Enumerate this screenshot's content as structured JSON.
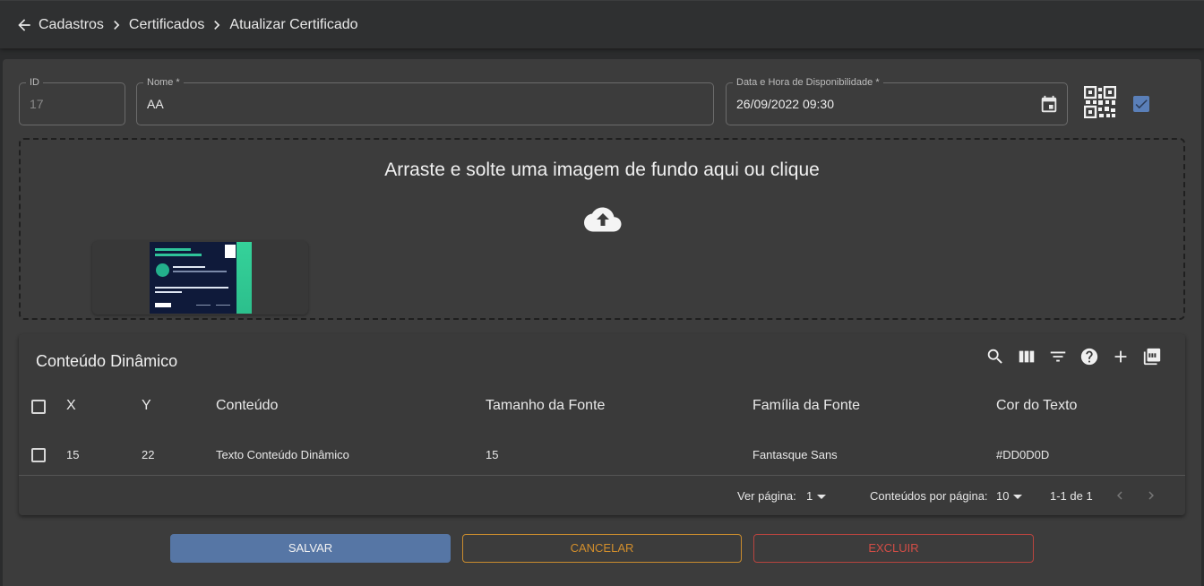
{
  "breadcrumb": {
    "items": [
      "Cadastros",
      "Certificados",
      "Atualizar Certificado"
    ]
  },
  "form": {
    "id": {
      "label": "ID",
      "value": "17"
    },
    "name": {
      "label": "Nome *",
      "value": "AA"
    },
    "availability": {
      "label": "Data e Hora de Disponibilidade *",
      "value": "26/09/2022 09:30"
    },
    "checkbox_checked": true
  },
  "dropzone": {
    "message": "Arraste e solte uma imagem de fundo aqui ou clique"
  },
  "table": {
    "title": "Conteúdo Dinâmico",
    "columns": [
      "X",
      "Y",
      "Conteúdo",
      "Tamanho da Fonte",
      "Família da Fonte",
      "Cor do Texto"
    ],
    "rows": [
      {
        "x": "15",
        "y": "22",
        "content": "Texto Conteúdo Dinâmico",
        "font_size": "15",
        "font_family": "Fantasque Sans",
        "color": "#DD0D0D"
      }
    ],
    "pagination": {
      "page_label": "Ver página:",
      "page": "1",
      "per_page_label": "Conteúdos por página:",
      "per_page": "10",
      "range": "1-1 de 1"
    }
  },
  "actions": {
    "save": "SALVAR",
    "cancel": "CANCELAR",
    "delete": "EXCLUIR"
  },
  "colors": {
    "primary": "#5676a5",
    "warning": "#d28e2c",
    "danger": "#d24d46"
  }
}
